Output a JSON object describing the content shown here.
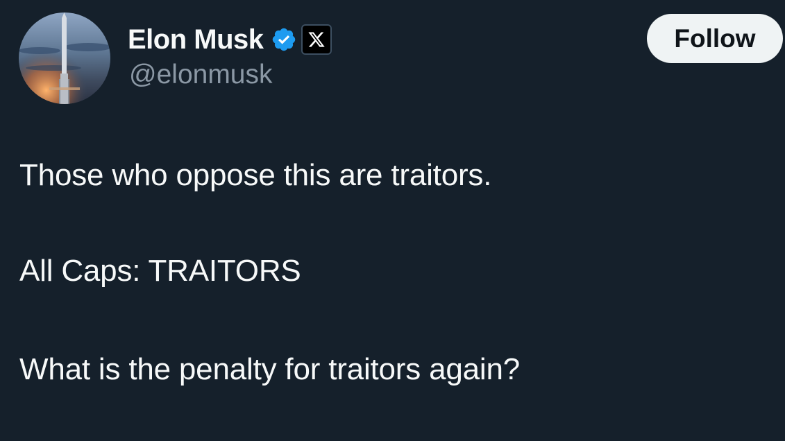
{
  "author": {
    "display_name": "Elon Musk",
    "handle": "@elonmusk",
    "verified_badge_icon": "verified-check-icon",
    "affiliation_icon": "x-logo-icon",
    "avatar_description_icon": "rocket-avatar"
  },
  "follow_button": {
    "label": "Follow"
  },
  "tweet": {
    "lines": [
      "Those who oppose this are traitors.",
      "All Caps: TRAITORS",
      "What is the penalty for traitors again?"
    ]
  },
  "colors": {
    "background": "#15202b",
    "primary_text": "#f7f9f9",
    "secondary_text": "#8b98a5",
    "verified_blue": "#1d9bf0",
    "follow_button_bg": "#eff3f4"
  }
}
